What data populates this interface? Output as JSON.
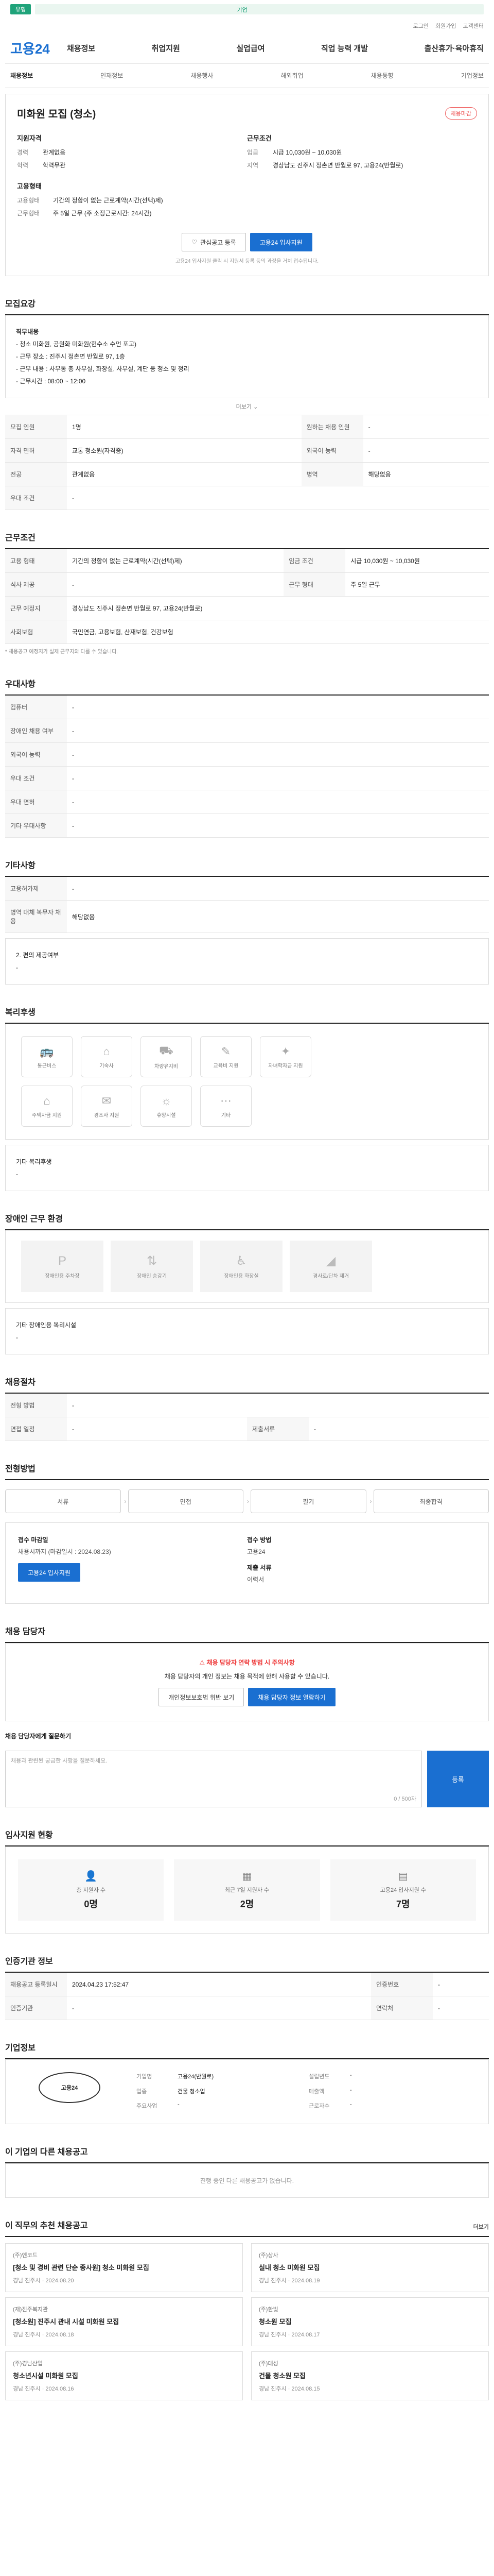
{
  "top": {
    "tag": "유형",
    "notice": "기업"
  },
  "util": [
    "로그인",
    "회원가입",
    "고객센터"
  ],
  "logo": "고용24",
  "gnb": [
    "채용정보",
    "취업지원",
    "실업급여",
    "직업 능력 개발",
    "출산휴가·육아휴직"
  ],
  "lnb": [
    "채용정보",
    "인재정보",
    "채용행사",
    "해외취업",
    "채용동향",
    "기업정보"
  ],
  "summary": {
    "title": "미화원 모집 (청소)",
    "badge": "채용마감",
    "col1_title": "지원자격",
    "col1": [
      {
        "k": "경력",
        "v": "관계없음"
      },
      {
        "k": "학력",
        "v": "학력무관"
      }
    ],
    "col2_title": "근무조건",
    "col2": [
      {
        "k": "임금",
        "v": "시급 10,030원 ~ 10,030원"
      },
      {
        "k": "지역",
        "v": "경상남도 진주시 정촌면 반월로 97, 고용24(반월로)"
      }
    ],
    "col3_title": "고용형태",
    "col3": [
      {
        "k": "고용형태",
        "v": "기간의 정함이 없는 근로계약(시간(선택)제)"
      },
      {
        "k": "근무형태",
        "v": "주 5일 근무 (주 소정근로시간: 24시간)"
      }
    ],
    "btn_interest": "관심공고 등록",
    "btn_apply": "고용24 입사지원",
    "note": "고용24 입사지원 클릭 시 지원서 등록 등의 과정을 거쳐 접수됩니다."
  },
  "recruit": {
    "title": "모집요강",
    "body": [
      "직무내용",
      "- 청소 미화원, 공원화 미화원(현수소 수먼 포고)",
      "- 근무 장소 : 진주시 정촌면 반월로 97, 1층",
      "- 근무 내용 : 사무동 총 사무실, 화장실, 사무실, 계단 등 청소 및 정리",
      "- 근무시간 : 08:00 ~ 12:00"
    ],
    "more": "더보기"
  },
  "recruit_table": [
    {
      "k": "모집 인원",
      "v": "1명",
      "k2": "원하는 채용 인원",
      "v2": "-"
    },
    {
      "k": "자격 면허",
      "v": "교통 청소원(자격증)",
      "k2": "외국어 능력",
      "v2": "-"
    },
    {
      "k": "전공",
      "v": "관계없음",
      "k2": "병역",
      "v2": "해당없음"
    },
    {
      "k": "우대 조건",
      "v": "-",
      "k2": "",
      "v2": ""
    }
  ],
  "work": {
    "title": "근무조건",
    "rows": [
      {
        "k": "고용 형태",
        "v": "기간의 정함이 없는 근로계약(시간(선택)제)"
      },
      {
        "k": "임금 조건",
        "v": "시급 10,030원 ~ 10,030원"
      },
      {
        "k": "식사 제공",
        "v": "-"
      },
      {
        "k": "근무 형태",
        "v": "주 5일 근무"
      },
      {
        "k": "근무 예정지",
        "v": "경상남도 진주시 정촌면 반월로 97, 고용24(반월로)"
      },
      {
        "k": "사회보험",
        "v": "국민연금, 고용보험, 산재보험, 건강보험"
      }
    ],
    "note": "* 채용공고 예정지가 실제 근무지와 다를 수 있습니다."
  },
  "pref": {
    "title": "우대사항",
    "rows": [
      {
        "k": "컴퓨터",
        "v": "-"
      },
      {
        "k": "장애인 채용 여부",
        "v": "-"
      },
      {
        "k": "외국어 능력",
        "v": "-"
      },
      {
        "k": "우대 조건",
        "v": "-"
      },
      {
        "k": "우대 면허",
        "v": "-"
      },
      {
        "k": "기타 우대사항",
        "v": "-"
      }
    ]
  },
  "extra": {
    "title": "기타사항",
    "rows": [
      {
        "k": "고용허가제",
        "v": "-"
      },
      {
        "k": "병역 대체 복무자 채용",
        "v": "해당없음"
      }
    ],
    "note_title": "2. 편의 제공여부",
    "note": "-"
  },
  "welfare": {
    "title": "복리후생",
    "items": [
      "통근버스",
      "기숙사",
      "차량유지비",
      "교육비 지원",
      "자녀학자금 지원",
      "주택자금 지원",
      "경조사 지원",
      "휴양시설",
      "기타"
    ],
    "other_title": "기타 복리후생",
    "other": "-"
  },
  "disabled": {
    "title": "장애인 근무 환경",
    "items": [
      "장애인용 주차장",
      "장애인 승강기",
      "장애인용 화장실",
      "경사로/단차 제거"
    ],
    "other_title": "기타 장애인용 복리시설",
    "other": "-"
  },
  "process": {
    "title": "채용절차",
    "rows": [
      {
        "k": "전형 방법",
        "v": "-",
        "k2": "",
        "v2": ""
      },
      {
        "k": "면접 일정",
        "v": "-",
        "k2": "제출서류",
        "v2": "-"
      }
    ]
  },
  "steps": {
    "title": "전형방법",
    "items": [
      "서류",
      "면접",
      "필기",
      "최종합격"
    ]
  },
  "apply": {
    "col1_title": "접수 마감일",
    "col1_val": "채용시까지 (마감일시 : 2024.08.23)",
    "btn": "고용24 입사지원",
    "col2_title": "접수 방법",
    "col2_val": "고용24",
    "col3_title": "제출 서류",
    "col3_val": "이력서"
  },
  "contact": {
    "title": "채용 담당자",
    "warn_title": "채용 담당자 연락 방법 시 주의사항",
    "warn_desc": "채용 담당자의 개인 정보는 채용 목적에 한해 사용할 수 있습니다.",
    "btn1": "개인정보보호법 위반 보기",
    "btn2": "채용 담당자 정보 열람하기"
  },
  "question": {
    "title": "채용 담당자에게 질문하기",
    "placeholder": "채용과 관련된 궁금한 사항을 질문하세요.",
    "count": "0 / 500자",
    "send": "등록"
  },
  "stats": {
    "title": "입사지원 현황",
    "items": [
      {
        "label": "총 지원자 수",
        "num": "0명"
      },
      {
        "label": "최근 7일 지원자 수",
        "num": "2명"
      },
      {
        "label": "고용24 입사지원 수",
        "num": "7명"
      }
    ]
  },
  "info": {
    "title": "인증기관 정보",
    "rows": [
      {
        "k": "채용공고 등록일시",
        "v": "2024.04.23 17:52:47",
        "k2": "인증번호",
        "v2": "-"
      },
      {
        "k": "인증기관",
        "v": "-",
        "k2": "연락처",
        "v2": "-"
      }
    ]
  },
  "company": {
    "title": "기업정보",
    "logo_text": "고용24",
    "rows": [
      {
        "k": "기업명",
        "v": "고용24(반월로)"
      },
      {
        "k": "설립년도",
        "v": "-"
      },
      {
        "k": "업종",
        "v": "건물 청소업"
      },
      {
        "k": "매출액",
        "v": "-"
      },
      {
        "k": "주요사업",
        "v": "-"
      },
      {
        "k": "근로자수",
        "v": "-"
      }
    ]
  },
  "other": {
    "title": "이 기업의 다른 채용공고",
    "empty": "진행 중인 다른 채용공고가 없습니다."
  },
  "recommend": {
    "title": "이 직무의 추천 채용공고",
    "link": "더보기",
    "items": [
      {
        "co": "(주)엔코드",
        "tt": "[청소 및 경비 관련 단순 종사원] 청소 미화원 모집",
        "meta": "경남 진주시 · 2024.08.20"
      },
      {
        "co": "(주)상사",
        "tt": "실내 청소 미화원 모집",
        "meta": "경남 진주시 · 2024.08.19"
      },
      {
        "co": "(재)진주복지관",
        "tt": "[청소원] 진주시 관내 시설 미화원 모집",
        "meta": "경남 진주시 · 2024.08.18"
      },
      {
        "co": "(주)한빛",
        "tt": "청소원 모집",
        "meta": "경남 진주시 · 2024.08.17"
      },
      {
        "co": "(주)경남산업",
        "tt": "청소년시설 미화원 모집",
        "meta": "경남 진주시 · 2024.08.16"
      },
      {
        "co": "(주)대성",
        "tt": "건물 청소원 모집",
        "meta": "경남 진주시 · 2024.08.15"
      }
    ]
  }
}
